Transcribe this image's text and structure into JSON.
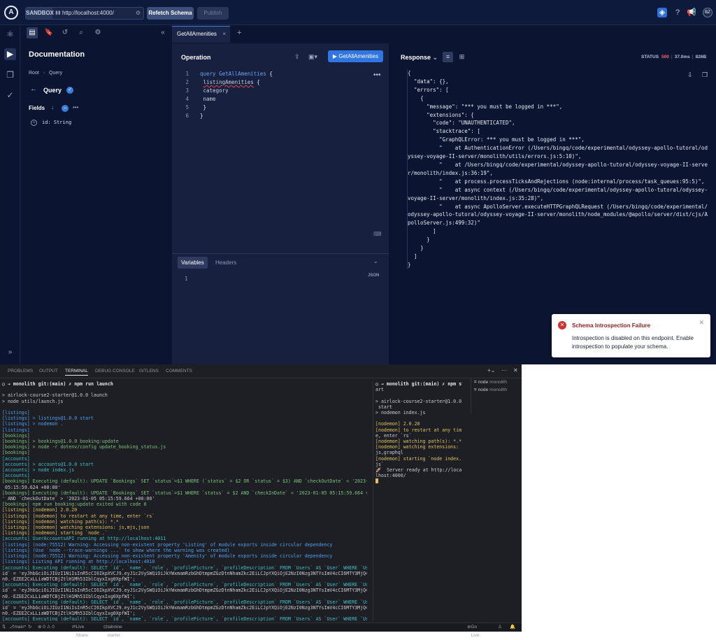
{
  "topbar": {
    "logo": "A",
    "sandbox_tag": "SANDBOX",
    "url": "http://localhost:4000/",
    "refetch_label": "Refetch Schema",
    "publish_label": "Publish",
    "avatar": "BZ"
  },
  "docs": {
    "title": "Documentation",
    "crumb_root": "Root",
    "crumb_sep": "›",
    "crumb_current": "Query",
    "type_title": "Query",
    "fields_label": "Fields",
    "field_name": "id",
    "field_type": "String"
  },
  "tabs": {
    "active": "GetAllAmenities"
  },
  "operation": {
    "heading": "Operation",
    "run_label": "GetAllAmenities",
    "lines": [
      "1",
      "2",
      "3",
      "4",
      "5",
      "6"
    ],
    "code_kw": "query",
    "code_name": "GetAllAmenities",
    "code_field": "listingAmenities",
    "code_sub1": "category",
    "code_sub2": "name"
  },
  "variables": {
    "tab_variables": "Variables",
    "tab_headers": "Headers",
    "format": "JSON",
    "line": "1"
  },
  "response": {
    "heading": "Response",
    "status_label": "STATUS",
    "status_code": "500",
    "time": "37.0ms",
    "size": "826B",
    "body": "{\n  \"data\": {},\n  \"errors\": [\n    {\n      \"message\": \"*** you must be logged in ***\",\n      \"extensions\": {\n        \"code\": \"UNAUTHENTICATED\",\n        \"stacktrace\": [\n          \"GraphQLError: *** you must be logged in ***\",\n          \"    at AuthenticationError (/Users/bingq/code/experimental/odyssey-apollo-tutoral/odyssey-voyage-II-server/monolith/utils/errors.js:5:10)\",\n          \"    at /Users/bingq/code/experimental/odyssey-apollo-tutoral/odyssey-voyage-II-server/monolith/index.js:36:19\",\n          \"    at process.processTicksAndRejections (node:internal/process/task_queues:95:5)\",\n          \"    at async context (/Users/bingq/code/experimental/odyssey-apollo-tutoral/odyssey-voyage-II-server/monolith/index.js:35:28)\",\n          \"    at async ApolloServer.executeHTTPGraphQLRequest (/Users/bingq/code/experimental/odyssey-apollo-tutoral/odyssey-voyage-II-server/monolith/node_modules/@apollo/server/dist/cjs/ApolloServer.js:499:32)\"\n        ]\n      }\n    }\n  ]\n}"
  },
  "toast": {
    "title": "Schema Introspection Failure",
    "body": "Introspection is disabled on this endpoint. Enable introspection to populate your schema."
  },
  "terminal": {
    "tabs": [
      "PROBLEMS",
      "OUTPUT",
      "TERMINAL",
      "DEBUG CONSOLE",
      "GITLENS",
      "COMMENTS"
    ],
    "sessions": [
      {
        "name": "node",
        "cwd": "monolith"
      },
      {
        "name": "node",
        "cwd": "monolith"
      }
    ],
    "pane1": [
      "○ → monolith git:(main) ✗ npm run launch",
      "",
      "> airlock-course2-starter@1.0.0 launch",
      "> node utils/launch.js",
      "",
      "[listings]",
      "[listings] > listings@1.0.0 start",
      "[listings] > nodemon .",
      "[listings]",
      "[bookings]",
      "[bookings] > bookings@1.0.0 booking:update",
      "[bookings] > node -r dotenv/config update_booking_status.js",
      "[bookings]",
      "[accounts]",
      "[accounts] > accounts@1.0.0 start",
      "[accounts] > node index.js",
      "[accounts]",
      "[bookings] Executing (default): UPDATE `Bookings` SET `status`=$1 WHERE (`status` = $2 OR `status` = $3) AND `checkOutDate` < '2023-01-05",
      " 05:15:59.624 +00:00'",
      "[bookings] Executing (default): UPDATE `Bookings` SET `status`=$1 WHERE `status` = $2 AND `checkInDate` < '2023-01-05 05:15:59.664 +00:00",
      "' AND `checkOutDate` > '2023-01-05 05:15:59.664 +00:00'",
      "[bookings] npm run booking:update exited with code 0",
      "[listings] [nodemon] 2.0.20",
      "[listings] [nodemon] to restart at any time, enter `rs`",
      "[listings] [nodemon] watching path(s): *.*",
      "[listings] [nodemon] watching extensions: js,mjs,json",
      "[listings] [nodemon] starting `node .`",
      "[accounts] UserAccountsAPI running at http://localhost:4011",
      "[listings] (node:75512) Warning: Accessing non-existent property 'Listing' of module exports inside circular dependency",
      "[listings] (Use `node --trace-warnings ...` to show where the warning was created)",
      "[listings] (node:75512) Warning: Accessing non-existent property 'Amenity' of module exports inside circular dependency",
      "[listings] Listing API running at http://localhost:4010",
      "[accounts] Executing (default): SELECT `id`, `name`, `role`, `profilePicture`, `profileDescription` FROM `Users` AS `User` WHERE `User`.`",
      "id` = 'eyJhbGciOiJIUzI1NiIsInR5cCI6IkpXVCJ9.eyJ1c2VySWQiOiJkYWxmamRzbGhDtmpmZGzDtnNhamZkc2EiLCJpYXQiOjE2NzI0Nzg3NTYsImV4cCI6MTY3MjQ4MDU1N",
      "n0.-EZEE2CxLLiaWDTCBjZtlH1Mh53IblCqyxIxg0XpfWI';",
      "[accounts] Executing (default): SELECT `id`, `name`, `role`, `profilePicture`, `profileDescription` FROM `Users` AS `User` WHERE `User`.`",
      "id` = 'eyJhbGciOiJIUzI1NiIsInR5cCI6IkpXVCJ9.eyJ1c2VySWQiOiJkYWxmamRzbGhDtmpmZGzDtnNhamZkc2EiLCJpYXQiOjE2NzI0Nzg3NTYsImV4cCI6MTY3MjQ4MDU1N",
      "n0.-EZEE2CxLLiaWDTCBjZtlH1Mh53IblCqyxIxg0XpfWI';",
      "[accounts] Executing (default): SELECT `id`, `name`, `role`, `profilePicture`, `profileDescription` FROM `Users` AS `User` WHERE `User`.`",
      "id` = 'eyJhbGciOiJIUzI1NiIsInR5cCI6IkpXVCJ9.eyJ1c2VySWQiOiJkYWxmamRzbGhDtmpmZGzDtnNhamZkc2EiLCJpYXQiOjE2NzI0Nzg3NTYsImV4cCI6MTY3MjQ4MDU1N",
      "n0.-EZEE2CxLLiaWDTCBjZtlH1Mh53IblCqyxIxg0XpfWI';",
      "[accounts] Executing (default): SELECT `id`, `name`, `role`, `profilePicture`, `profileDescription` FROM `Users` AS `User` WHERE `User`.`",
      "id` = 'eyJhbGciOiJIUzI1NiIsInR5cCI6IkpXVCJ9.eyJ1c2VySWQiOiJkYWxmamRzbGhDtmpmZGzDtnNhamZkc2EiLCJpYXQiOjE2NzI0Nzg3NTYsImV4cCI6MTY3MjQ4MDU1N",
      "n0.-EZEE2CxLLiaWDTCBjZtlH1Mh53IblCqyxIxg0XpfWI';",
      "[accounts] Executing (default): SELECT `id`, `name`, `role`, `profilePicture`, `profileDescription` FROM `Users` AS `User` WHERE `User`.`",
      "id` = 'eyJhbGciOiJIUzI1NiIsInR5cCI6IkpXVCJ9.eyJ1c2VySWQiOiJkYWxmamRzbGhDtmpmZGzDtnNhamZkc2EiLCJpYXQiOjE2NzI0Nzg3NTYsImV4cCI6MTY3MjQ4MDU1N"
    ],
    "pane2": [
      "○ → monolith git:(main) ✗ npm st",
      "art",
      "",
      "> airlock-course2-starter@1.0.0",
      " start",
      "> nodemon index.js",
      "",
      "[nodemon] 2.0.20",
      "[nodemon] to restart at any tim",
      "e, enter `rs`",
      "[nodemon] watching path(s): *.*",
      "[nodemon] watching extensions:",
      "js,graphql",
      "[nodemon] starting `node index.",
      "js`",
      "🚀  Server ready at http://loca",
      "lhost:4000/"
    ]
  },
  "statusbar": {
    "branch": "main*",
    "problems": "⊗ 0 ⚠ 0",
    "live": "Live Share",
    "tabnine": "tabnine starter",
    "golive": "Go Live"
  }
}
